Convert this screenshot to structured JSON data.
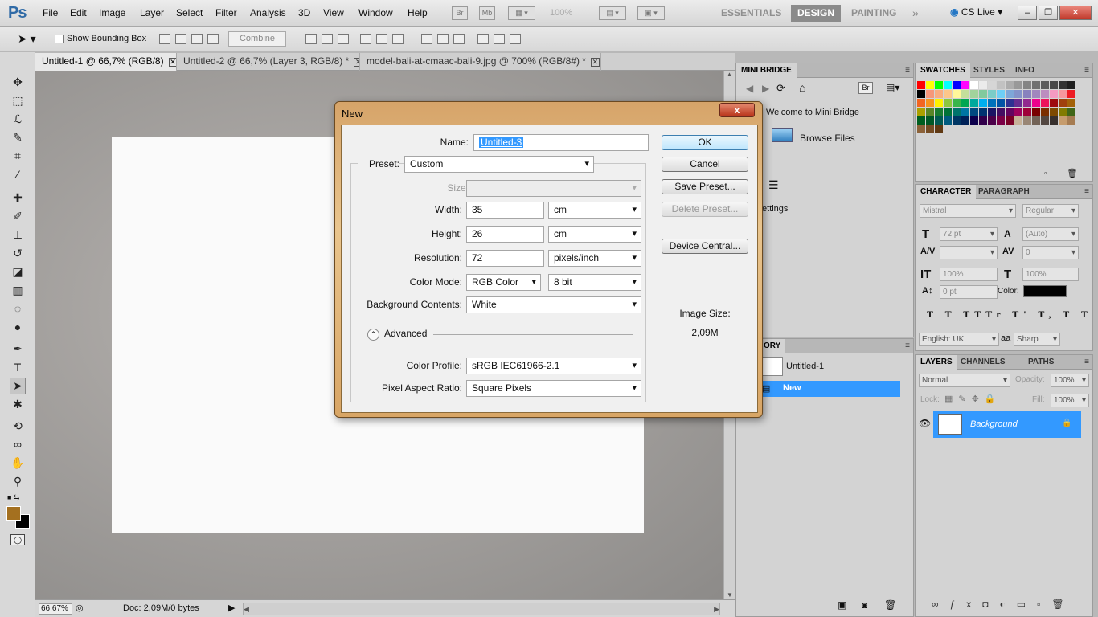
{
  "app": {
    "logo": "Ps",
    "menu": [
      "File",
      "Edit",
      "Image",
      "Layer",
      "Select",
      "Filter",
      "Analysis",
      "3D",
      "View",
      "Window",
      "Help"
    ],
    "zoom_readout": "100%",
    "workspaces": [
      "ESSENTIALS",
      "DESIGN",
      "PAINTING"
    ],
    "active_workspace": "DESIGN",
    "cs_live": "CS Live",
    "bridge_btn": "Br",
    "minibridge_btn": "Mb"
  },
  "options": {
    "show_bounding_box": "Show Bounding Box",
    "combine": "Combine"
  },
  "tabs": [
    {
      "label": "Untitled-1 @ 66,7% (RGB/8)",
      "active": true
    },
    {
      "label": "Untitled-2 @ 66,7% (Layer 3, RGB/8) *",
      "active": false
    },
    {
      "label": "model-bali-at-cmaac-bali-9.jpg @ 700% (RGB/8#) *",
      "active": false
    }
  ],
  "status": {
    "zoom": "66,67%",
    "doc": "Doc: 2,09M/0 bytes"
  },
  "mini_bridge": {
    "tab": "MINI BRIDGE",
    "welcome": "Welcome to Mini Bridge",
    "browse": "Browse Files",
    "settings": "ettings",
    "br": "Br"
  },
  "swatches_panel": {
    "tabs": [
      "SWATCHES",
      "STYLES",
      "INFO"
    ],
    "colors": [
      "#ff0000",
      "#ffff00",
      "#00ff00",
      "#00ffff",
      "#0000ff",
      "#ff00ff",
      "#ffffff",
      "#ebebeb",
      "#d6d6d6",
      "#c2c2c2",
      "#adadad",
      "#999999",
      "#858585",
      "#707070",
      "#5c5c5c",
      "#474747",
      "#333333",
      "#1f1f1f",
      "#000000",
      "#f7977a",
      "#f9ad81",
      "#fdc68a",
      "#fff79a",
      "#c4df9b",
      "#a2d39c",
      "#82ca9d",
      "#7bcdc8",
      "#6ecff6",
      "#7ea7d8",
      "#8493ca",
      "#8882be",
      "#a187be",
      "#bc8dbf",
      "#f49ac2",
      "#f6989d",
      "#ed1c24",
      "#f26522",
      "#f7941d",
      "#fff200",
      "#8dc73f",
      "#39b54a",
      "#00a651",
      "#00a99d",
      "#00aeef",
      "#0072bc",
      "#0054a6",
      "#2e3192",
      "#662d91",
      "#92278f",
      "#ec008c",
      "#ed145b",
      "#9e0b0f",
      "#a0410d",
      "#a36209",
      "#aba000",
      "#598527",
      "#197b30",
      "#007236",
      "#00746b",
      "#0076a3",
      "#004a80",
      "#003471",
      "#1b1464",
      "#440e62",
      "#630460",
      "#9e005d",
      "#9e0039",
      "#790000",
      "#7b2e00",
      "#7d4900",
      "#827b00",
      "#406618",
      "#005e20",
      "#005826",
      "#005952",
      "#005b7f",
      "#003663",
      "#002157",
      "#0d004c",
      "#32004b",
      "#4b0049",
      "#7b0046",
      "#7a0026",
      "#c7b299",
      "#998675",
      "#736357",
      "#534741",
      "#37302d",
      "#c69c6d",
      "#a67c52",
      "#8c6239",
      "#754c24",
      "#603913"
    ]
  },
  "character_panel": {
    "tabs": [
      "CHARACTER",
      "PARAGRAPH"
    ],
    "font_family": "Mistral",
    "font_style": "Regular",
    "font_size": "72 pt",
    "leading": "(Auto)",
    "tracking": "0",
    "vscale": "100%",
    "hscale": "100%",
    "baseline": "0 pt",
    "color_label": "Color:",
    "color": "#000000",
    "language": "English: UK",
    "aa_label": "a",
    "antialias": "Sharp",
    "glyphs": [
      "T",
      "T",
      "TT",
      "Tr",
      "T'",
      "T,",
      "T",
      "T"
    ]
  },
  "history_panel": {
    "tab": "ORY",
    "snapshot": "Untitled-1",
    "item": "New"
  },
  "layers_panel": {
    "tabs": [
      "LAYERS",
      "CHANNELS",
      "PATHS"
    ],
    "blend_mode": "Normal",
    "opacity_label": "Opacity:",
    "opacity": "100%",
    "lock_label": "Lock:",
    "fill_label": "Fill:",
    "fill": "100%",
    "layer_name": "Background"
  },
  "dialog": {
    "title": "New",
    "close": "x",
    "name_label": "Name:",
    "name_value": "Untitled-3",
    "preset_label": "Preset:",
    "preset": "Custom",
    "size_label": "Size:",
    "width_label": "Width:",
    "width": "35",
    "width_unit": "cm",
    "height_label": "Height:",
    "height": "26",
    "height_unit": "cm",
    "resolution_label": "Resolution:",
    "resolution": "72",
    "resolution_unit": "pixels/inch",
    "color_mode_label": "Color Mode:",
    "color_mode": "RGB Color",
    "bit_depth": "8 bit",
    "bg_label": "Background Contents:",
    "bg": "White",
    "advanced": "Advanced",
    "color_profile_label": "Color Profile:",
    "color_profile": "sRGB IEC61966-2.1",
    "pixel_aspect_label": "Pixel Aspect Ratio:",
    "pixel_aspect": "Square Pixels",
    "ok": "OK",
    "cancel": "Cancel",
    "save_preset": "Save Preset...",
    "delete_preset": "Delete Preset...",
    "device_central": "Device Central...",
    "image_size_label": "Image Size:",
    "image_size": "2,09M"
  },
  "colors": {
    "foreground": "#a4701f",
    "background": "#000000",
    "accent": "#3399ff"
  }
}
